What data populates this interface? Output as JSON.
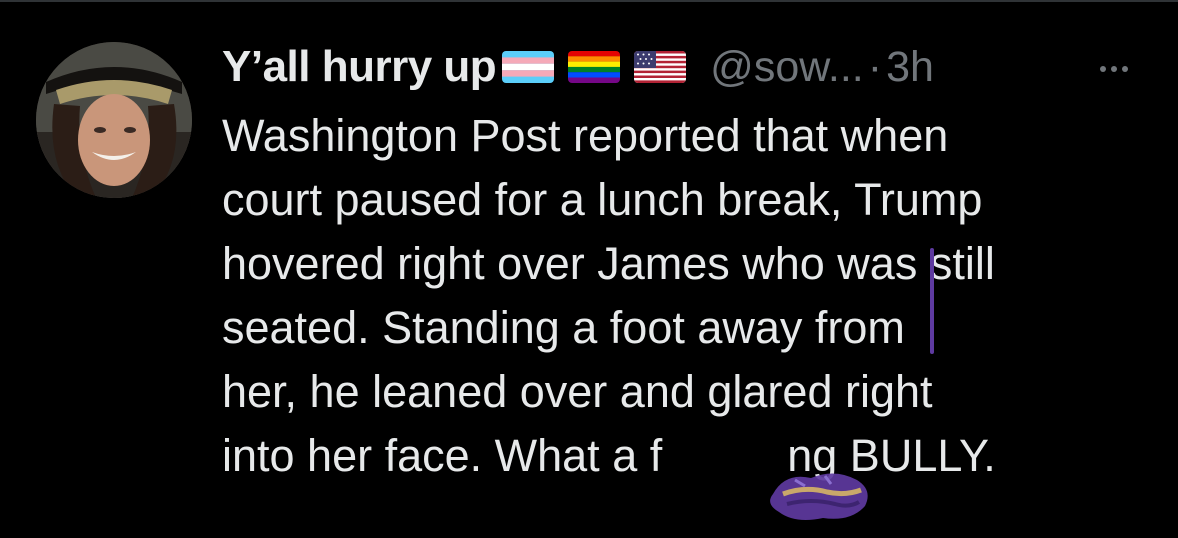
{
  "tweet": {
    "author_name": "Y’all hurry up",
    "flags": [
      "transgender-flag",
      "rainbow-flag",
      "us-flag"
    ],
    "handle": "@sow...",
    "separator": "·",
    "time": "3h",
    "more_label": "More options",
    "text_lines": [
      "Washington Post reported that when",
      "court paused for a lunch break, Trump",
      "hovered right over James who was still",
      "seated. Standing a foot away from",
      "her, he leaned over and glared right",
      "into her face. What a f          ng BULLY."
    ]
  },
  "colors": {
    "background": "#000000",
    "primary_text": "#e7e9ea",
    "secondary_text": "#71767b",
    "scribble": "#5e3aa0"
  }
}
